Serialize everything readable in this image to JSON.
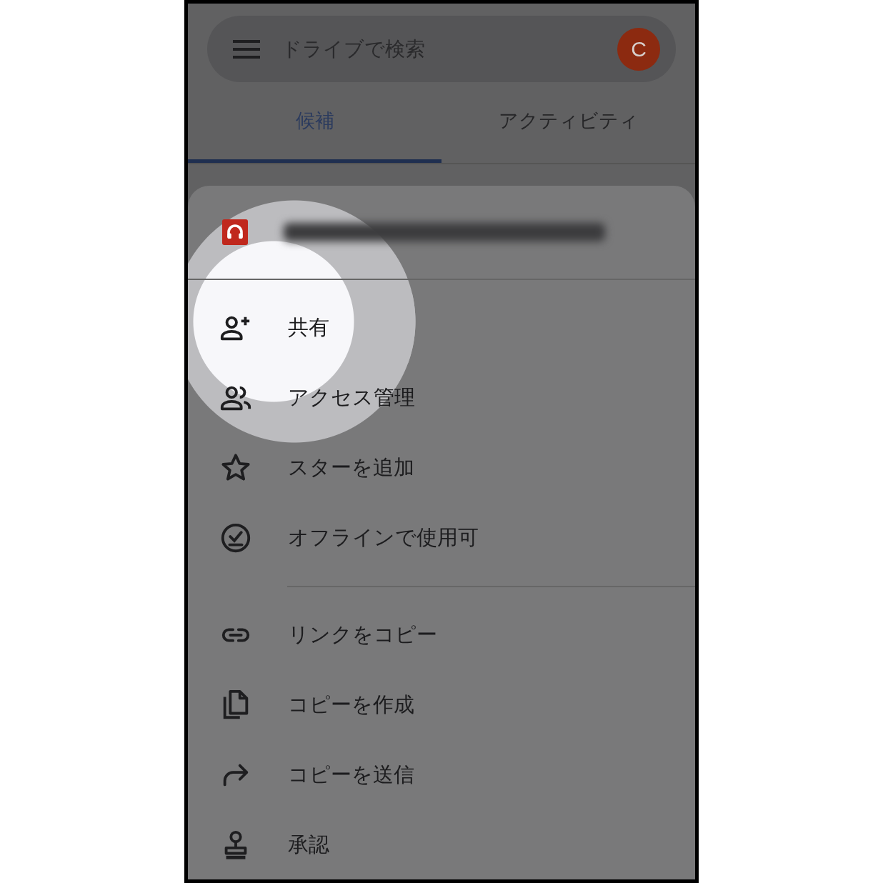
{
  "search": {
    "placeholder": "ドライブで検索",
    "avatar": "C"
  },
  "tabs": [
    {
      "label": "候補",
      "selected": true
    },
    {
      "label": "アクティビティ",
      "selected": false
    }
  ],
  "menu_groups": [
    [
      {
        "label": "共有",
        "pressed": true
      },
      {
        "label": "アクセス管理",
        "pressed": false
      },
      {
        "label": "スターを追加",
        "pressed": false
      },
      {
        "label": "オフラインで使用可",
        "pressed": false
      }
    ],
    [
      {
        "label": "リンクをコピー",
        "pressed": false
      },
      {
        "label": "コピーを作成",
        "pressed": false
      },
      {
        "label": "コピーを送信",
        "pressed": false
      },
      {
        "label": "承認",
        "pressed": false
      }
    ]
  ]
}
